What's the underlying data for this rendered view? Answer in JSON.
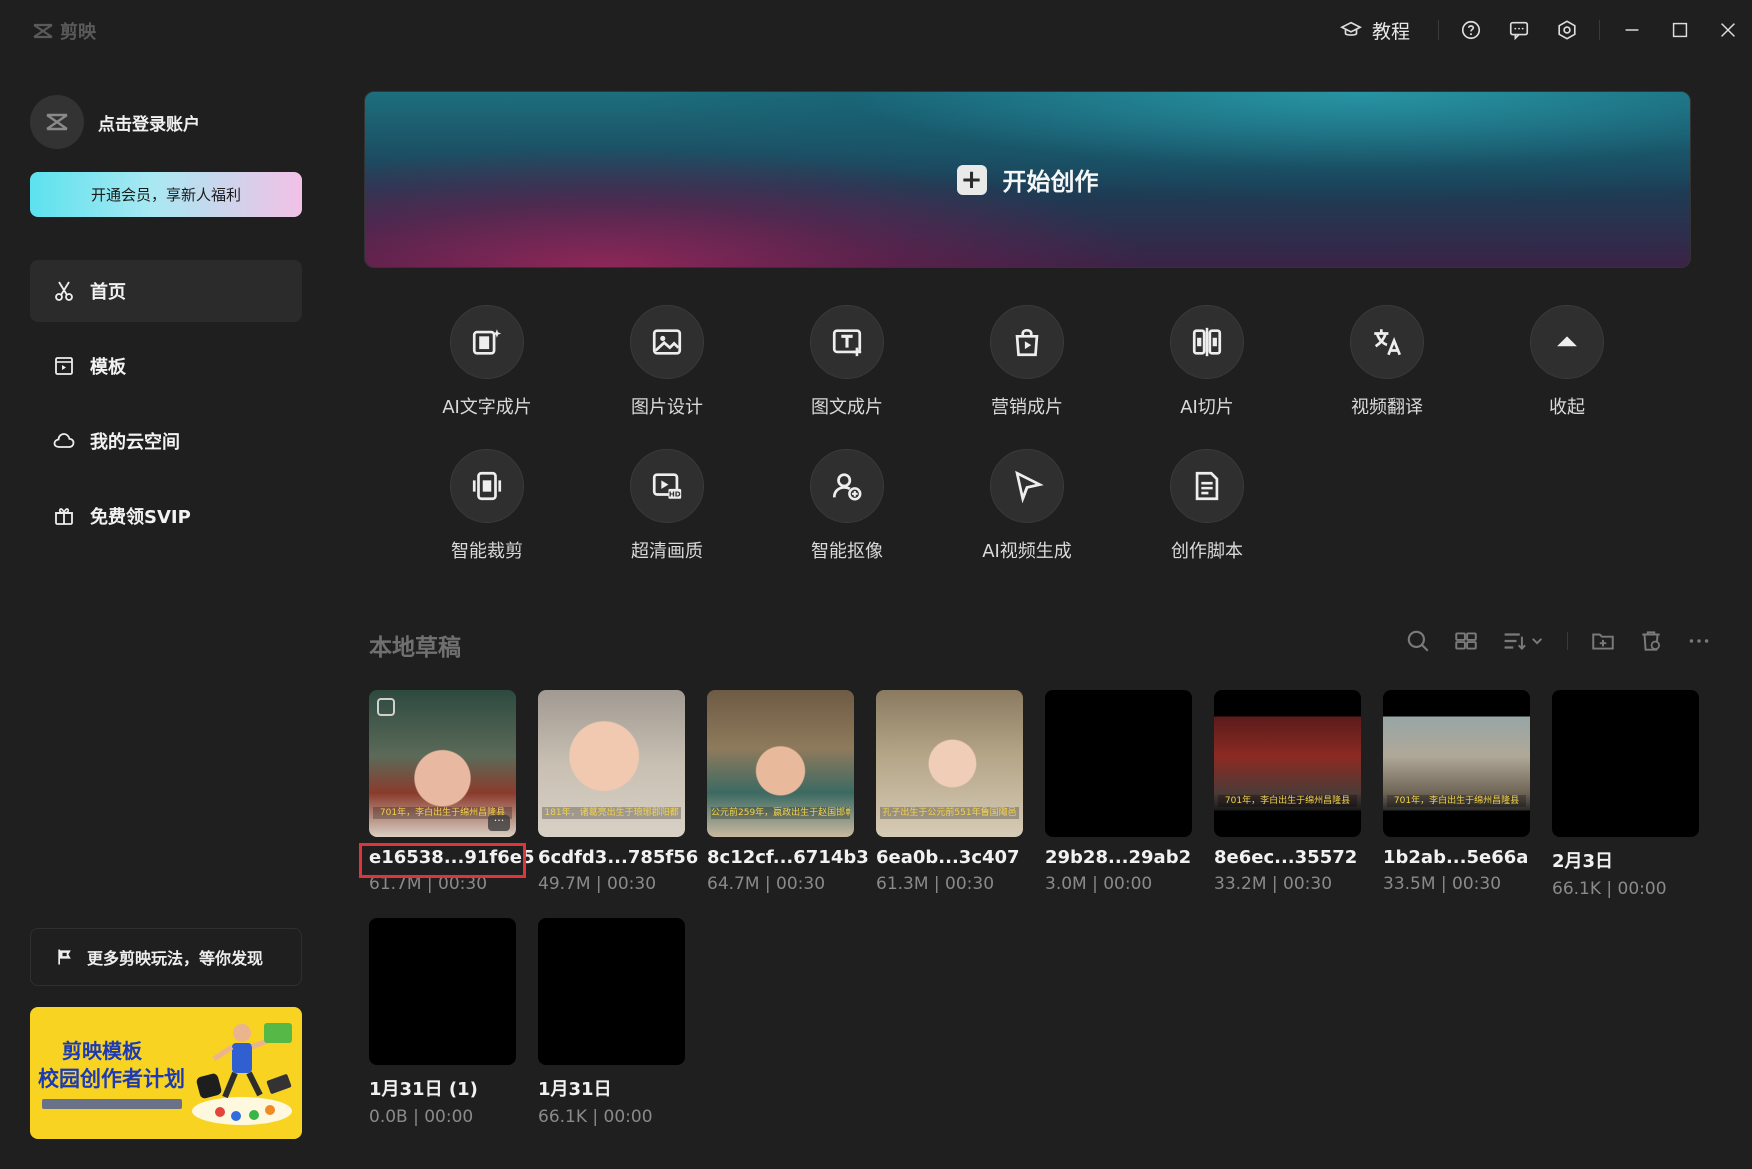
{
  "app": {
    "logo_text": "剪映"
  },
  "titlebar": {
    "tutorial_label": "教程"
  },
  "sidebar": {
    "account_label": "点击登录账户",
    "vip_button": "开通会员，享新人福利",
    "nav": [
      {
        "label": "首页",
        "icon": "scissors-icon",
        "active": true
      },
      {
        "label": "模板",
        "icon": "template-icon"
      },
      {
        "label": "我的云空间",
        "icon": "cloud-icon"
      },
      {
        "label": "免费领SVIP",
        "icon": "gift-icon"
      }
    ],
    "discover_label": "更多剪映玩法，等你发现",
    "banner": {
      "title1": "剪映模板",
      "title2": "校园创作者计划"
    }
  },
  "hero": {
    "label": "开始创作"
  },
  "tools": [
    {
      "label": "AI文字成片",
      "icon": "ai-text-video-icon"
    },
    {
      "label": "图片设计",
      "icon": "image-design-icon"
    },
    {
      "label": "图文成片",
      "icon": "image-text-video-icon"
    },
    {
      "label": "营销成片",
      "icon": "marketing-bag-icon"
    },
    {
      "label": "AI切片",
      "icon": "ai-slice-icon"
    },
    {
      "label": "视频翻译",
      "icon": "translate-icon"
    },
    {
      "label": "收起",
      "icon": "collapse-up-icon"
    },
    {
      "label": "智能裁剪",
      "icon": "smart-crop-icon"
    },
    {
      "label": "超清画质",
      "icon": "hd-quality-icon"
    },
    {
      "label": "智能抠像",
      "icon": "matting-icon"
    },
    {
      "label": "AI视频生成",
      "icon": "ai-video-gen-icon"
    },
    {
      "label": "创作脚本",
      "icon": "script-icon"
    }
  ],
  "drafts": {
    "title": "本地草稿",
    "items": [
      {
        "name": "e16538...91f6e5",
        "meta": "61.7M | 00:30",
        "subtitle": "701年，李白出生于绵州昌隆县"
      },
      {
        "name": "6cdfd3...785f56",
        "meta": "49.7M | 00:30",
        "subtitle": "181年，诸葛亮出生于琅琊郡阳都"
      },
      {
        "name": "8c12cf...6714b3",
        "meta": "64.7M | 00:30",
        "subtitle": "公元前259年，嬴政出生于赵国邯郸"
      },
      {
        "name": "6ea0b...3c407",
        "meta": "61.3M | 00:30",
        "subtitle": "孔子出生于公元前551年鲁国陬邑"
      },
      {
        "name": "29b28...29ab2",
        "meta": "3.0M | 00:00",
        "subtitle": ""
      },
      {
        "name": "8e6ec...35572",
        "meta": "33.2M | 00:30",
        "subtitle": "701年，李白出生于绵州昌隆县"
      },
      {
        "name": "1b2ab...5e66a",
        "meta": "33.5M | 00:30",
        "subtitle": "701年，李白出生于绵州昌隆县"
      },
      {
        "name": "2月3日",
        "meta": "66.1K | 00:00",
        "subtitle": ""
      },
      {
        "name": "1月31日 (1)",
        "meta": "0.0B | 00:00",
        "subtitle": ""
      },
      {
        "name": "1月31日",
        "meta": "66.1K | 00:00",
        "subtitle": ""
      }
    ]
  }
}
